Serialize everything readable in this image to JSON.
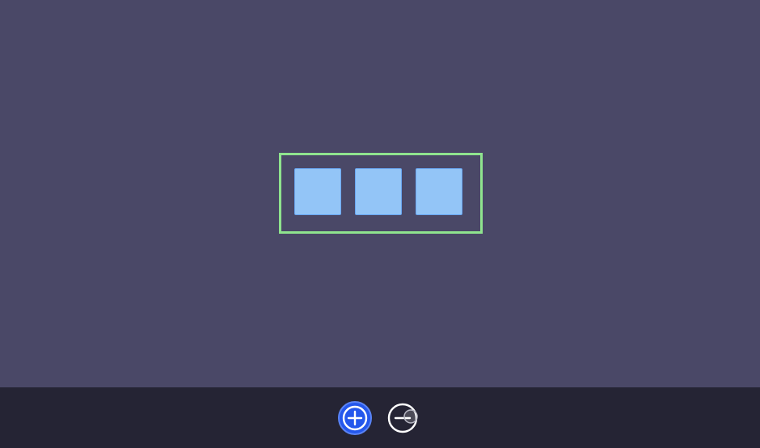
{
  "stage": {
    "background": "#4a4867",
    "container": {
      "border_color": "#8fe48e",
      "items": [
        {
          "name": "box-1",
          "color": "#93c5f7"
        },
        {
          "name": "box-2",
          "color": "#93c5f7"
        },
        {
          "name": "box-3",
          "color": "#93c5f7"
        }
      ]
    }
  },
  "toolbar": {
    "background": "#252434",
    "add_button": {
      "icon": "plus-circle-icon",
      "color": "#2457ec"
    },
    "remove_button": {
      "icon": "minus-circle-icon",
      "color": "#ffffff"
    }
  }
}
